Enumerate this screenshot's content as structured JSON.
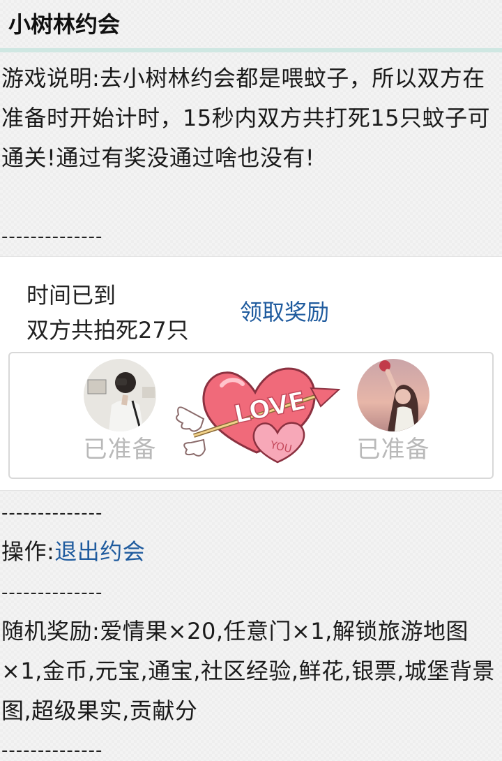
{
  "header": {
    "title": "小树林约会"
  },
  "description": {
    "text": "游戏说明:去小树林约会都是喂蚊子，所以双方在准备时开始计时，15秒内双方共打死15只蚊子可通关!通过有奖没通过啥也没有!"
  },
  "separator": "--------------",
  "result": {
    "status_line1": "时间已到",
    "status_line2": "双方共拍死27只",
    "claim_label": "领取奖励",
    "left_player": {
      "state": "已准备",
      "avatar_icon": "user-avatar-photo"
    },
    "right_player": {
      "state": "已准备",
      "avatar_icon": "user-avatar-photo"
    },
    "heart_badge": {
      "big_text": "LOVE",
      "small_text": "YOU",
      "icon": "heart-arrow-icon"
    }
  },
  "operation": {
    "label": "操作:",
    "exit_link": "退出约会"
  },
  "rewards": {
    "text": "随机奖励:爱情果×20,任意门×1,解锁旅游地图×1,金币,元宝,通宝,社区经验,鲜花,银票,城堡背景图,超级果实,贡献分"
  },
  "colors": {
    "link": "#1f5b9e",
    "accent_rule": "#cfe7e2",
    "ready_text": "#b9b9b9",
    "heart": "#f06a7a"
  }
}
